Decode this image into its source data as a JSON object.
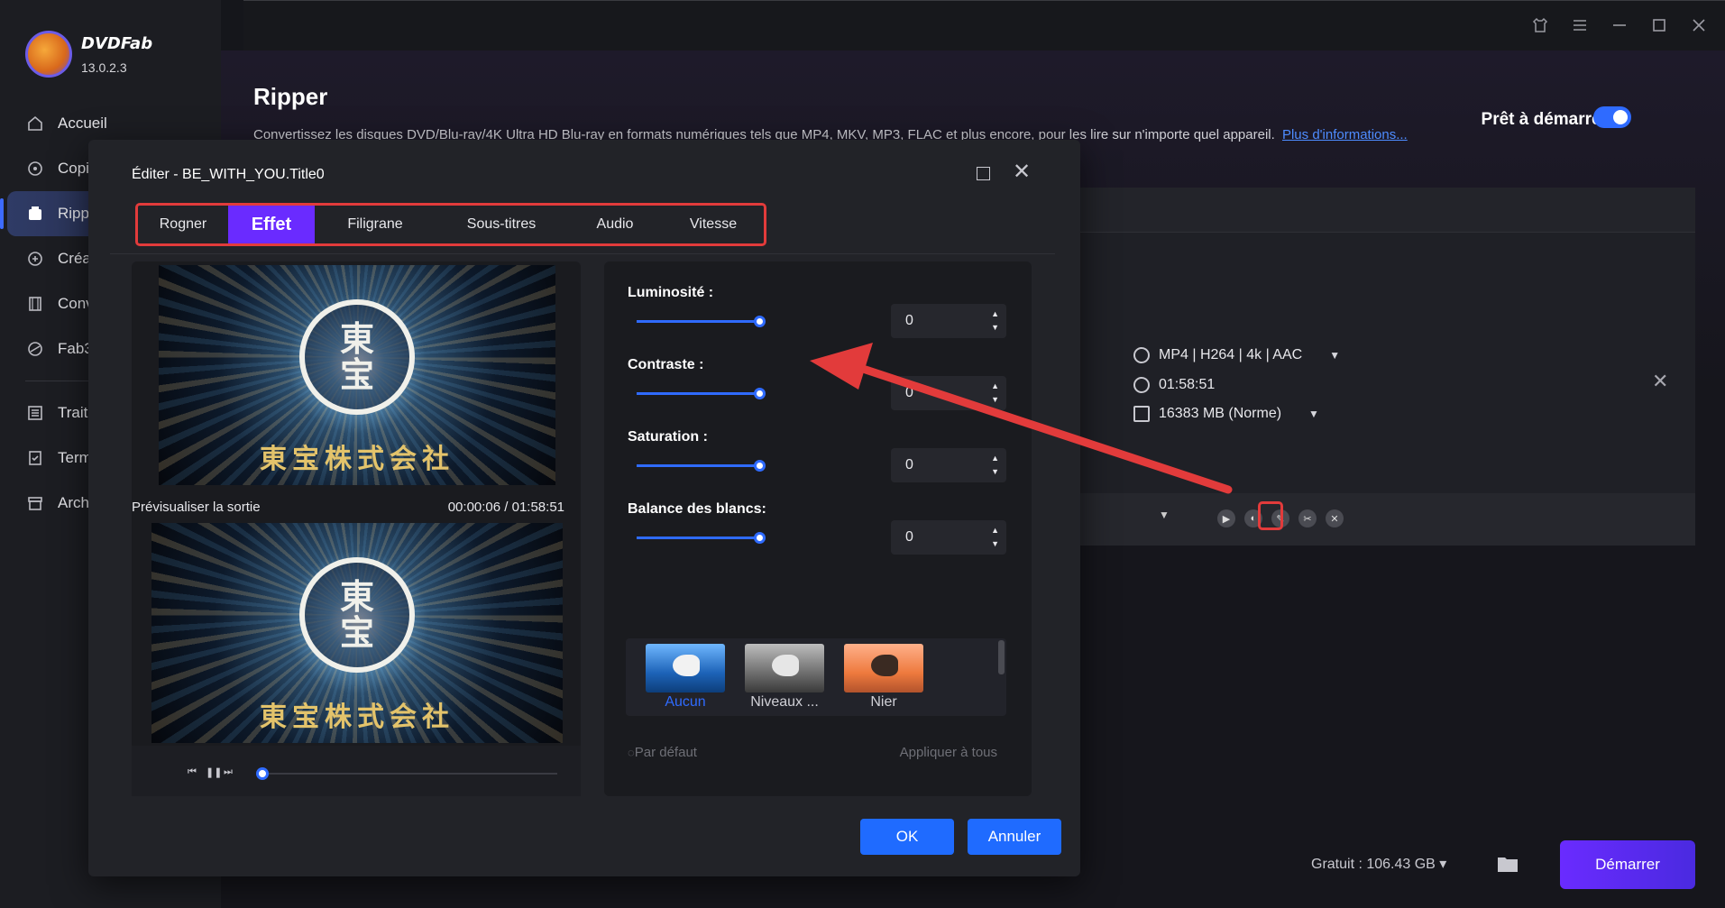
{
  "app": {
    "brand": "DVDFab",
    "version": "13.0.2.3"
  },
  "sidebar": {
    "items": [
      {
        "label": "Accueil",
        "icon": "home-icon"
      },
      {
        "label": "Copi",
        "icon": "copy-icon"
      },
      {
        "label": "Ripp",
        "icon": "ripper-icon",
        "active": true
      },
      {
        "label": "Créa",
        "icon": "creator-icon"
      },
      {
        "label": "Conv",
        "icon": "converter-icon"
      },
      {
        "label": "Fab3",
        "icon": "fab3-icon"
      }
    ],
    "items2": [
      {
        "label": "Trait",
        "icon": "task-icon"
      },
      {
        "label": "Term",
        "icon": "finished-icon"
      },
      {
        "label": "Arch",
        "icon": "archive-icon"
      }
    ]
  },
  "main": {
    "title": "Ripper",
    "description": "Convertissez les disques DVD/Blu-ray/4K Ultra HD Blu-ray en formats numériques tels que MP4, MKV, MP3, FLAC et plus encore, pour les lire sur n'importe quel appareil.",
    "more_link": "Plus d'informations..."
  },
  "task": {
    "ready_label": "Prêt à démarrer",
    "format": "MP4 | H264 | 4k | AAC",
    "duration": "01:58:51",
    "size": "16383 MB (Norme)"
  },
  "bottom": {
    "free_space": "Gratuit : 106.43 GB",
    "start_button": "Démarrer"
  },
  "dialog": {
    "title": "Éditer - BE_WITH_YOU.Title0",
    "tabs": [
      {
        "label": "Rogner"
      },
      {
        "label": "Effet",
        "active": true
      },
      {
        "label": "Filigrane"
      },
      {
        "label": "Sous-titres"
      },
      {
        "label": "Audio"
      },
      {
        "label": "Vitesse"
      }
    ],
    "video": {
      "emblem_top": "東",
      "emblem_bottom": "宝",
      "company": "東宝株式会社",
      "preview_label": "Prévisualiser la sortie",
      "time": "00:00:06 / 01:58:51"
    },
    "effects": {
      "brightness_label": "Luminosité :",
      "brightness_value": "0",
      "contrast_label": "Contraste :",
      "contrast_value": "0",
      "saturation_label": "Saturation :",
      "saturation_value": "0",
      "white_balance_label": "Balance des blancs:",
      "white_balance_value": "0",
      "presets": [
        {
          "name": "Aucun",
          "selected": true
        },
        {
          "name": "Niveaux ..."
        },
        {
          "name": "Nier"
        }
      ],
      "default_label": "Par défaut",
      "apply_all_label": "Appliquer à tous"
    },
    "ok_label": "OK",
    "cancel_label": "Annuler"
  },
  "colors": {
    "accent_purple": "#6a2bff",
    "accent_blue": "#1f6bff",
    "annotation_red": "#e23b3b"
  }
}
